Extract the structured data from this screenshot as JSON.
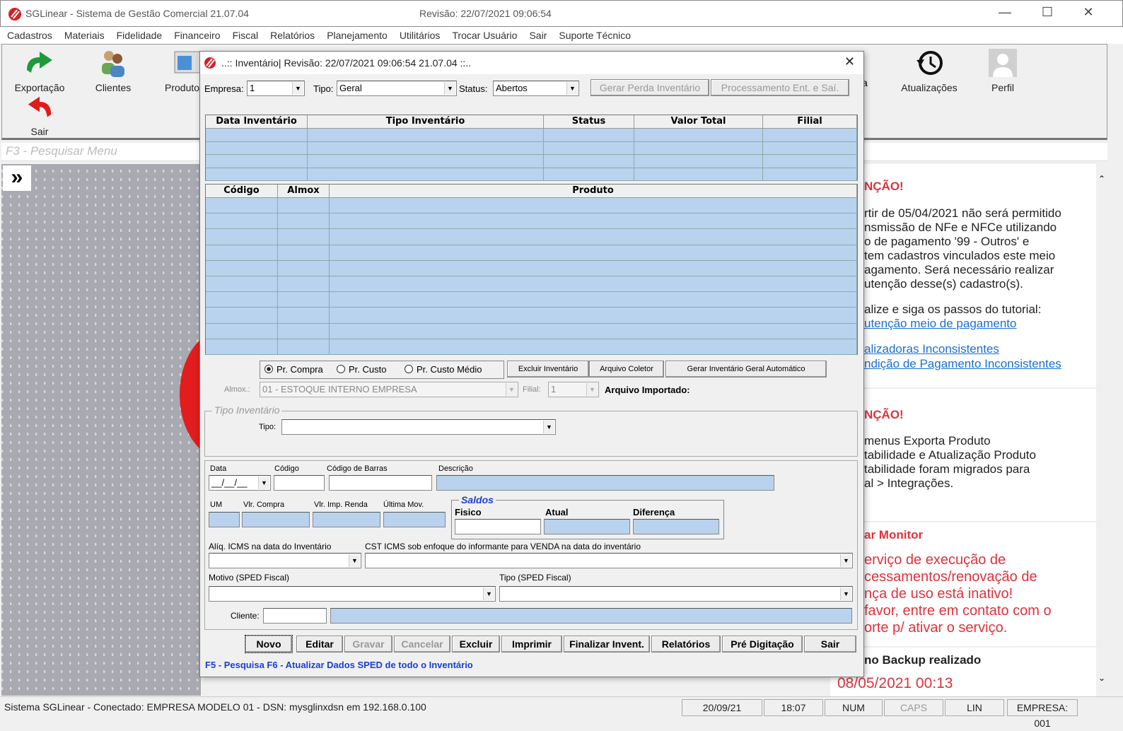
{
  "app": {
    "title": "SGLinear - Sistema de Gestão Comercial 21.07.04",
    "revision": "Revisão: 22/07/2021 09:06:54"
  },
  "menu": [
    "Cadastros",
    "Materiais",
    "Fidelidade",
    "Financeiro",
    "Fiscal",
    "Relatórios",
    "Planejamento",
    "Utilitários",
    "Trocar Usuário",
    "Sair",
    "Suporte Técnico"
  ],
  "toolbar": {
    "exportacao": "Exportação",
    "clientes": "Clientes",
    "produtos": "Produto",
    "sair": "Sair",
    "atualizacoes": "Atualizações",
    "perfil": "Perfil",
    "partial": "a"
  },
  "search": {
    "placeholder": "F3 - Pesquisar Menu"
  },
  "notices": {
    "title1": "NÇÃO!",
    "lines1": [
      "rtir de 05/04/2021 não será permitido",
      "nsmissão de NFe e NFCe utilizando",
      "o de pagamento '99 - Outros' e",
      "tem cadastros vinculados este meio",
      "agamento. Será necessário realizar",
      "utenção desse(s) cadastro(s)."
    ],
    "tutorial": "alize e siga os passos do tutorial:",
    "link1": "utenção meio de pagamento",
    "link2": "alizadoras Inconsistentes",
    "link3": "ndição de Pagamento Inconsistentes",
    "title2": "NÇÃO!",
    "lines2": [
      "menus Exporta Produto",
      "tabilidade e Atualização Produto",
      "tabilidade foram migrados para",
      "al > Integrações."
    ],
    "title3": "ar Monitor",
    "lines3": [
      "erviço de execução de",
      "cessamentos/renovação de",
      "nça de uso está inativo!",
      "favor, entre em contato com o",
      "orte p/ ativar o serviço."
    ],
    "backup": "no Backup realizado",
    "backup_date": "08/05/2021 00:13"
  },
  "status": {
    "connection": "Sistema SGLinear - Conectado: EMPRESA MODELO 01 - DSN: mysglinxdsn em 192.168.0.100",
    "date": "20/09/21",
    "time": "18:07",
    "num": "NUM",
    "caps": "CAPS",
    "lin": "LIN",
    "empresa": "EMPRESA: 001"
  },
  "dialog": {
    "title": "..:: Inventário| Revisão: 22/07/2021 09:06:54  21.07.04 ::..",
    "empresa_label": "Empresa:",
    "empresa": "1",
    "tipo_label": "Tipo:",
    "tipo": "Geral",
    "status_label": "Status:",
    "status": "Abertos",
    "gerar_perda": "Gerar Perda Inventário",
    "processamento": "Processamento Ent. e Saí.",
    "grid1_cols": [
      "Data Inventário",
      "Tipo Inventário",
      "Status",
      "Valor Total",
      "Filial"
    ],
    "grid2_cols": [
      "Código",
      "Almox",
      "Produto"
    ],
    "radios": [
      {
        "label": "Pr. Compra",
        "checked": true
      },
      {
        "label": "Pr. Custo",
        "checked": false
      },
      {
        "label": "Pr. Custo Médio",
        "checked": false
      }
    ],
    "excluir_inv": "Excluir Inventário",
    "arquivo_coletor": "Arquivo Coletor",
    "gerar_auto": "Gerar Inventário Geral Automático",
    "almox_label": "Almox.:",
    "almox": "01 - ESTOQUE INTERNO EMPRESA",
    "filial_label": "Filial:",
    "filial": "1",
    "arquivo_importado": "Arquivo  Importado:",
    "tipo_inv_group": "Tipo Inventário",
    "tipo_inv_label": "Tipo:",
    "tipo_inv": "",
    "data_label": "Data",
    "data": "__/__/__",
    "codigo_label": "Código",
    "barras_label": "Código de Barras",
    "descricao_label": "Descrição",
    "um_label": "UM",
    "vlr_compra_label": "Vlr. Compra",
    "vlr_imp_label": "Vlr. Imp. Renda",
    "ultima_mov_label": "Última Mov.",
    "saldos_label": "Saldos",
    "fisico_label": "Fisico",
    "atual_label": "Atual",
    "diferenca_label": "Diferença",
    "aliq_label": "Alíq. ICMS na data do Inventário",
    "cst_label": "CST ICMS sob enfoque do informante para VENDA na data do inventário",
    "motivo_label": "Motivo (SPED Fiscal)",
    "tipo_sped_label": "Tipo (SPED Fiscal)",
    "cliente_label": "Cliente:",
    "buttons": [
      {
        "label": "Novo",
        "enabled": true
      },
      {
        "label": "Editar",
        "enabled": true
      },
      {
        "label": "Gravar",
        "enabled": false
      },
      {
        "label": "Cancelar",
        "enabled": false
      },
      {
        "label": "Excluir",
        "enabled": true
      },
      {
        "label": "Imprimir",
        "enabled": true
      },
      {
        "label": "Finalizar Invent.",
        "enabled": true
      },
      {
        "label": "Relatórios",
        "enabled": true
      },
      {
        "label": "Pré Digitação",
        "enabled": true
      },
      {
        "label": "Sair",
        "enabled": true
      }
    ],
    "hint": "F5 - Pesquisa   F6 - Atualizar Dados SPED de todo o Inventário"
  },
  "colors": {
    "grid_blue": "#b9d3ee",
    "alert_red": "#e0323c",
    "link_blue": "#1a6fd0"
  }
}
